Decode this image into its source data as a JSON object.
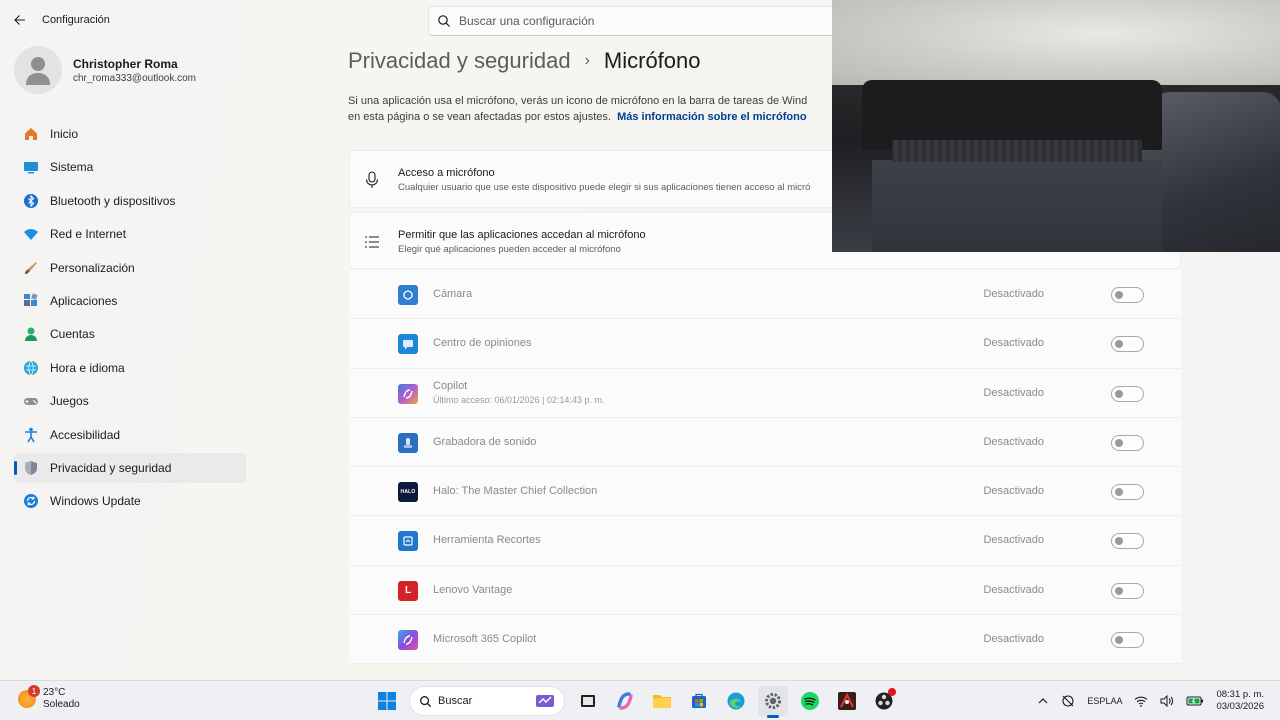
{
  "window": {
    "title": "Configuración",
    "search_placeholder": "Buscar una configuración"
  },
  "user": {
    "name": "Christopher Roma",
    "email": "chr_roma333@outlook.com"
  },
  "sidebar": {
    "items": [
      {
        "label": "Inicio",
        "icon": "home-icon"
      },
      {
        "label": "Sistema",
        "icon": "system-icon"
      },
      {
        "label": "Bluetooth y dispositivos",
        "icon": "bluetooth-icon"
      },
      {
        "label": "Red e Internet",
        "icon": "wifi-icon"
      },
      {
        "label": "Personalización",
        "icon": "brush-icon"
      },
      {
        "label": "Aplicaciones",
        "icon": "apps-icon"
      },
      {
        "label": "Cuentas",
        "icon": "account-icon"
      },
      {
        "label": "Hora e idioma",
        "icon": "globe-clock-icon"
      },
      {
        "label": "Juegos",
        "icon": "gamepad-icon"
      },
      {
        "label": "Accesibilidad",
        "icon": "accessibility-icon"
      },
      {
        "label": "Privacidad y seguridad",
        "icon": "shield-icon",
        "active": true
      },
      {
        "label": "Windows Update",
        "icon": "update-icon"
      }
    ]
  },
  "main": {
    "breadcrumb_parent": "Privacidad y seguridad",
    "breadcrumb_separator": "›",
    "breadcrumb_current": "Micrófono",
    "description_line1": "Si una aplicación usa el micrófono, verás un icono de micrófono en la barra de tareas de Wind",
    "description_line2": "en esta página o se vean afectadas por estos ajustes.",
    "learn_more_link": "Más información sobre el micrófono",
    "access_card": {
      "title": "Acceso a micrófono",
      "subtitle": "Cualquier usuario que use este dispositivo puede elegir si sus aplicaciones tienen acceso al micró"
    },
    "apps_card": {
      "title": "Permitir que las aplicaciones accedan al micrófono",
      "subtitle": "Elegir qué aplicaciones pueden acceder al micrófono"
    },
    "apps": [
      {
        "name": "Cámara",
        "state": "Desactivado",
        "color": "#2f7fd1",
        "enabled": false
      },
      {
        "name": "Centro de opiniones",
        "state": "Desactivado",
        "color": "#1e88d8",
        "enabled": false
      },
      {
        "name": "Copilot",
        "sub": "Último acceso: 06/01/2026  |  02:14:43 p. m.",
        "state": "Desactivado",
        "color": "#6a5cd6",
        "enabled": false
      },
      {
        "name": "Grabadora de sonido",
        "state": "Desactivado",
        "color": "#2b6fc2",
        "enabled": false
      },
      {
        "name": "Halo: The Master Chief Collection",
        "state": "Desactivado",
        "color": "#0b1a3a",
        "icon_text": "HALO",
        "enabled": false
      },
      {
        "name": "Herramienta Recortes",
        "state": "Desactivado",
        "color": "#1f77d0",
        "enabled": false
      },
      {
        "name": "Lenovo Vantage",
        "state": "Desactivado",
        "color": "#d2232a",
        "icon_text": "L",
        "enabled": false
      },
      {
        "name": "Microsoft 365 Copilot",
        "state": "Desactivado",
        "color": "#7b4fd8",
        "enabled": false
      }
    ]
  },
  "taskbar": {
    "weather_temp": "23°C",
    "weather_desc": "Soleado",
    "weather_badge": "1",
    "search_label": "Buscar",
    "lang_top": "ESP",
    "lang_bottom": "LAA",
    "time": "08:31 p. m.",
    "date": "03/03/2026"
  }
}
